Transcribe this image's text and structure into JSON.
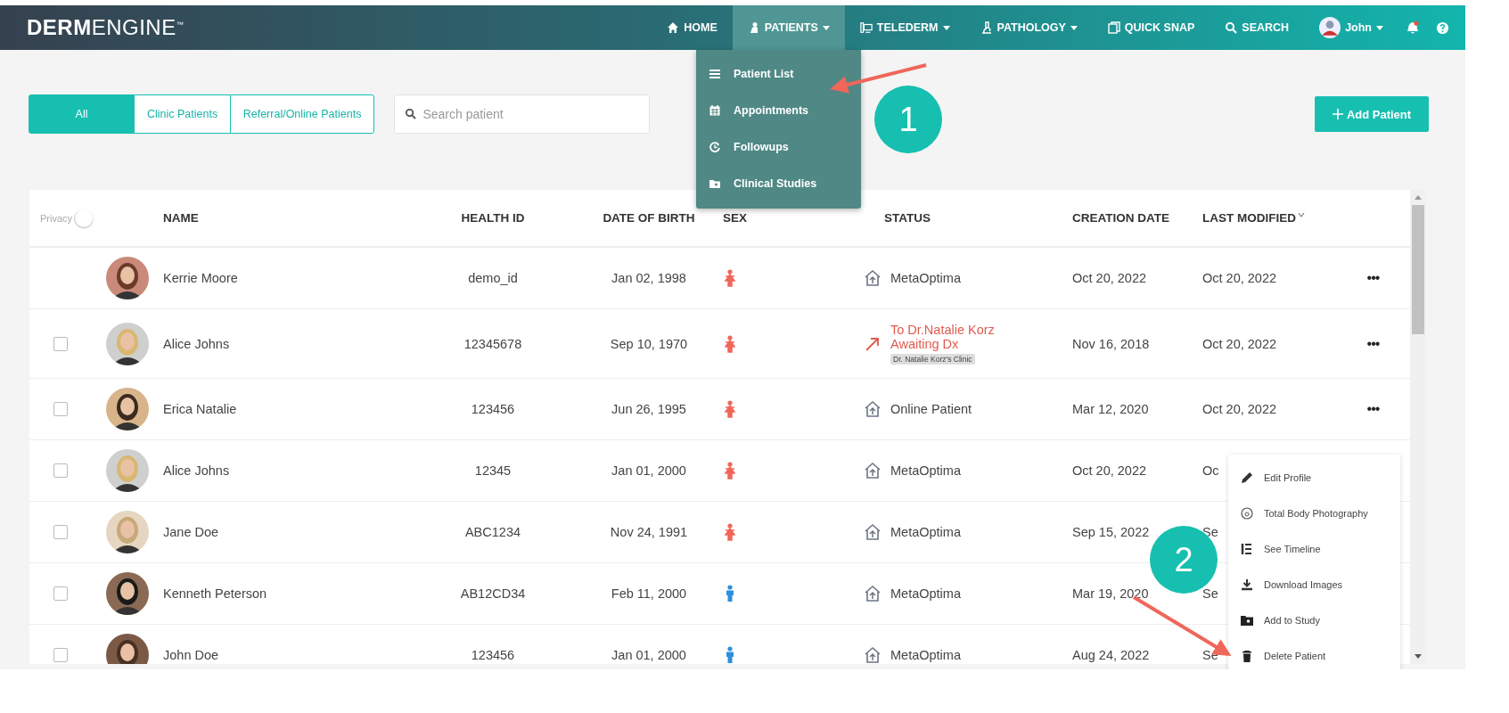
{
  "navbar": {
    "logo": "**DERM**ENGINE$^{™}$",
    "items": [
      {
        "label": "HOME",
        "caret": false,
        "selected": false
      },
      {
        "label": "PATIENTS",
        "caret": true,
        "selected": true
      },
      {
        "label": "TELEDERM",
        "caret": true,
        "selected": false
      },
      {
        "label": "PATHOLOGY",
        "caret": true,
        "selected": false
      },
      {
        "label": "QUICK SNAP",
        "caret": false,
        "selected": false
      },
      {
        "label": "SEARCH",
        "caret": false,
        "selected": false
      }
    ],
    "user": {
      "name": "John"
    },
    "notification": true
  },
  "patients_menu": [
    "Patient List",
    "Appointments",
    "Followups",
    "Clinical Studies"
  ],
  "filter_tabs": [
    {
      "label": "All",
      "selected": true
    },
    {
      "label": "Clinic Patients",
      "selected": false
    },
    {
      "label": "Referral/Online Patients",
      "selected": false
    }
  ],
  "search": {
    "placeholder": "Search patient"
  },
  "add_button": "Add Patient",
  "table": {
    "privacy": {
      "label": "Privacy",
      "on": false
    },
    "columns": [
      {
        "label": "NAME",
        "sorted": false
      },
      {
        "label": "HEALTH ID",
        "sorted": false
      },
      {
        "label": "DATE OF BIRTH",
        "sorted": false
      },
      {
        "label": "SEX",
        "sorted": false
      },
      {
        "label": "STATUS",
        "sorted": false
      },
      {
        "label": "CREATION DATE",
        "sorted": false
      },
      {
        "label": "LAST MODIFIED",
        "sorted": true
      }
    ],
    "rows": [
      {
        "name": "Kerrie Moore",
        "health_id": "demo_id",
        "dob": "Jan 02, 1998",
        "sex": {
          "kind": "female"
        },
        "status": {
          "kind": "clinic",
          "lines": [
            "MetaOptima"
          ]
        },
        "created": "Oct 20, 2022",
        "modified": "Oct 20, 2022",
        "actions": "•••"
      },
      {
        "checkbox": {
          "checked": false
        },
        "name": "Alice Johns",
        "health_id": "12345678",
        "dob": "Sep 10, 1970",
        "sex": {
          "kind": "female"
        },
        "status": {
          "kind": "referral",
          "lines": [
            "To Dr.Natalie Korz",
            "Awaiting Dx"
          ],
          "tag": "Dr. Natalie Korz's Clinic"
        },
        "created": "Nov 16, 2018",
        "modified": "Oct 20, 2022",
        "actions": "•••"
      },
      {
        "checkbox": {
          "checked": false
        },
        "name": "Erica Natalie",
        "health_id": "123456",
        "dob": "Jun 26, 1995",
        "sex": {
          "kind": "female"
        },
        "status": {
          "kind": "clinic",
          "lines": [
            "Online Patient"
          ]
        },
        "created": "Mar 12, 2020",
        "modified": "Oct 20, 2022",
        "actions": "•••"
      },
      {
        "checkbox": {
          "checked": false
        },
        "name": "Alice Johns",
        "health_id": "12345",
        "dob": "Jan 01, 2000",
        "sex": {
          "kind": "female"
        },
        "status": {
          "kind": "clinic",
          "lines": [
            "MetaOptima"
          ]
        },
        "created": "Oct 20, 2022",
        "modified": "Oc"
      },
      {
        "checkbox": {
          "checked": false
        },
        "name": "Jane Doe",
        "health_id": "ABC1234",
        "dob": "Nov 24, 1991",
        "sex": {
          "kind": "female"
        },
        "status": {
          "kind": "clinic",
          "lines": [
            "MetaOptima"
          ]
        },
        "created": "Sep 15, 2022",
        "modified": "Se"
      },
      {
        "checkbox": {
          "checked": false
        },
        "name": "Kenneth Peterson",
        "health_id": "AB12CD34",
        "dob": "Feb 11, 2000",
        "sex": {
          "kind": "male"
        },
        "status": {
          "kind": "clinic",
          "lines": [
            "MetaOptima"
          ]
        },
        "created": "Mar 19, 2020",
        "modified": "Se"
      },
      {
        "checkbox": {
          "checked": false
        },
        "name": "John Doe",
        "health_id": "123456",
        "dob": "Jan 01, 2000",
        "sex": {
          "kind": "male"
        },
        "status": {
          "kind": "clinic",
          "lines": [
            "MetaOptima"
          ]
        },
        "created": "Aug 24, 2022",
        "modified": "Se"
      }
    ]
  },
  "row_menu": [
    "Edit Profile",
    "Total Body Photography",
    "See Timeline",
    "Download Images",
    "Add to Study",
    "Delete Patient"
  ],
  "callouts": [
    {
      "label": "1"
    },
    {
      "label": "2"
    }
  ]
}
